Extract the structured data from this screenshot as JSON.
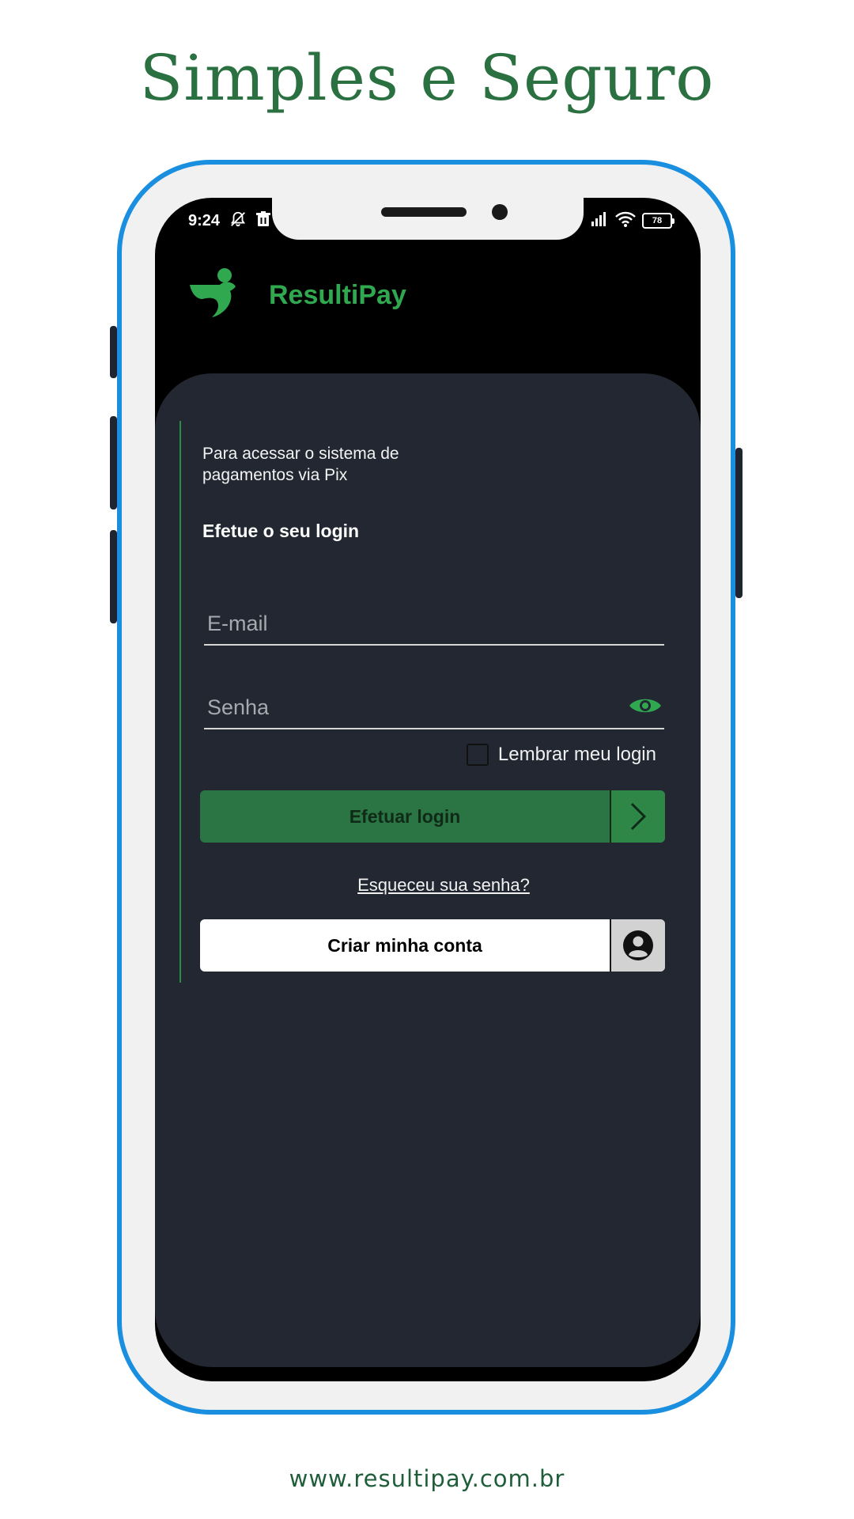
{
  "promo": {
    "headline": "Simples e Seguro",
    "website": "www.resultipay.com.br"
  },
  "status_bar": {
    "time": "9:24",
    "battery": "78",
    "icons": [
      "bell-off-icon",
      "trash-icon",
      "signal-icon",
      "wifi-icon",
      "battery-icon"
    ]
  },
  "app": {
    "name": "ResultiPay",
    "brand_color": "#2fa84f"
  },
  "login": {
    "intro": "Para acessar o sistema de pagamentos via Pix",
    "title": "Efetue o seu login",
    "email_placeholder": "E-mail",
    "password_placeholder": "Senha",
    "remember_label": "Lembrar meu login",
    "submit_label": "Efetuar login",
    "forgot_label": "Esqueceu sua senha?",
    "create_label": "Criar minha conta"
  },
  "colors": {
    "panel": "#222732",
    "button_green": "#2b7443",
    "frame_blue": "#1b8fdf",
    "headline_green": "#2a7040"
  }
}
